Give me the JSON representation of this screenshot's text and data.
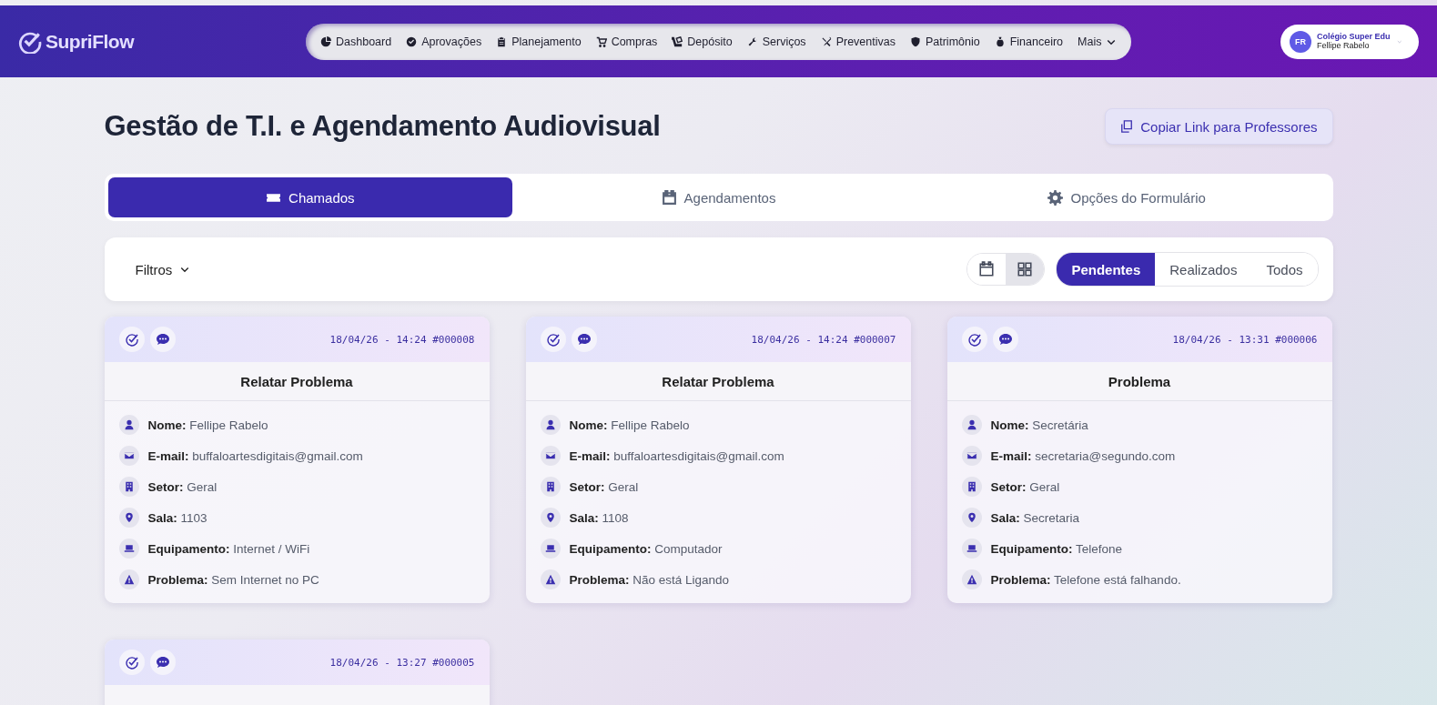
{
  "brand": "SupriFlow",
  "nav": [
    {
      "kind": "chart",
      "label": "Dashboard"
    },
    {
      "kind": "check",
      "label": "Aprovações"
    },
    {
      "kind": "clipboard",
      "label": "Planejamento"
    },
    {
      "kind": "cart",
      "label": "Compras"
    },
    {
      "kind": "dolly",
      "label": "Depósito"
    },
    {
      "kind": "wrench",
      "label": "Serviços"
    },
    {
      "kind": "tools",
      "label": "Preventivas"
    },
    {
      "kind": "shield",
      "label": "Patrimônio"
    },
    {
      "kind": "moneybag",
      "label": "Financeiro"
    },
    {
      "kind": "more",
      "label": "Mais"
    }
  ],
  "user": {
    "initials": "FR",
    "org": "Colégio Super Edu",
    "name": "Fellipe Rabelo"
  },
  "page_title": "Gestão de T.I. e Agendamento Audiovisual",
  "copy_button": "Copiar Link para Professores",
  "tabs": [
    {
      "kind": "ticket",
      "label": "Chamados",
      "selected": true
    },
    {
      "kind": "calendar",
      "label": "Agendamentos",
      "selected": false
    },
    {
      "kind": "gear",
      "label": "Opções do Formulário",
      "selected": false
    }
  ],
  "filters": "Filtros",
  "views": [
    {
      "kind": "calendar",
      "selected": false
    },
    {
      "kind": "grid",
      "selected": true
    }
  ],
  "status_tabs": [
    {
      "label": "Pendentes",
      "selected": true
    },
    {
      "label": "Realizados",
      "selected": false
    },
    {
      "label": "Todos",
      "selected": false
    }
  ],
  "cards": [
    {
      "stamp": "18/04/26 - 14:24 #000008",
      "title": "Relatar Problema",
      "fields": [
        {
          "kind": "user",
          "label": "Nome:",
          "value": "Fellipe Rabelo"
        },
        {
          "kind": "email",
          "label": "E-mail:",
          "value": "buffaloartesdigitais@gmail.com"
        },
        {
          "kind": "building",
          "label": "Setor:",
          "value": "Geral"
        },
        {
          "kind": "pin",
          "label": "Sala:",
          "value": "1103"
        },
        {
          "kind": "laptop",
          "label": "Equipamento:",
          "value": "Internet / WiFi"
        },
        {
          "kind": "warning",
          "label": "Problema:",
          "value": "Sem Internet no PC"
        }
      ]
    },
    {
      "stamp": "18/04/26 - 14:24 #000007",
      "title": "Relatar Problema",
      "fields": [
        {
          "kind": "user",
          "label": "Nome:",
          "value": "Fellipe Rabelo"
        },
        {
          "kind": "email",
          "label": "E-mail:",
          "value": "buffaloartesdigitais@gmail.com"
        },
        {
          "kind": "building",
          "label": "Setor:",
          "value": "Geral"
        },
        {
          "kind": "pin",
          "label": "Sala:",
          "value": "1108"
        },
        {
          "kind": "laptop",
          "label": "Equipamento:",
          "value": "Computador"
        },
        {
          "kind": "warning",
          "label": "Problema:",
          "value": "Não está Ligando"
        }
      ]
    },
    {
      "stamp": "18/04/26 - 13:31 #000006",
      "title": "Problema",
      "fields": [
        {
          "kind": "user",
          "label": "Nome:",
          "value": "Secretária"
        },
        {
          "kind": "email",
          "label": "E-mail:",
          "value": "secretaria@segundo.com"
        },
        {
          "kind": "building",
          "label": "Setor:",
          "value": "Geral"
        },
        {
          "kind": "pin",
          "label": "Sala:",
          "value": "Secretaria"
        },
        {
          "kind": "laptop",
          "label": "Equipamento:",
          "value": "Telefone"
        },
        {
          "kind": "warning",
          "label": "Problema:",
          "value": "Telefone está falhando."
        }
      ]
    },
    {
      "stamp": "18/04/26 - 13:27 #000005"
    }
  ]
}
